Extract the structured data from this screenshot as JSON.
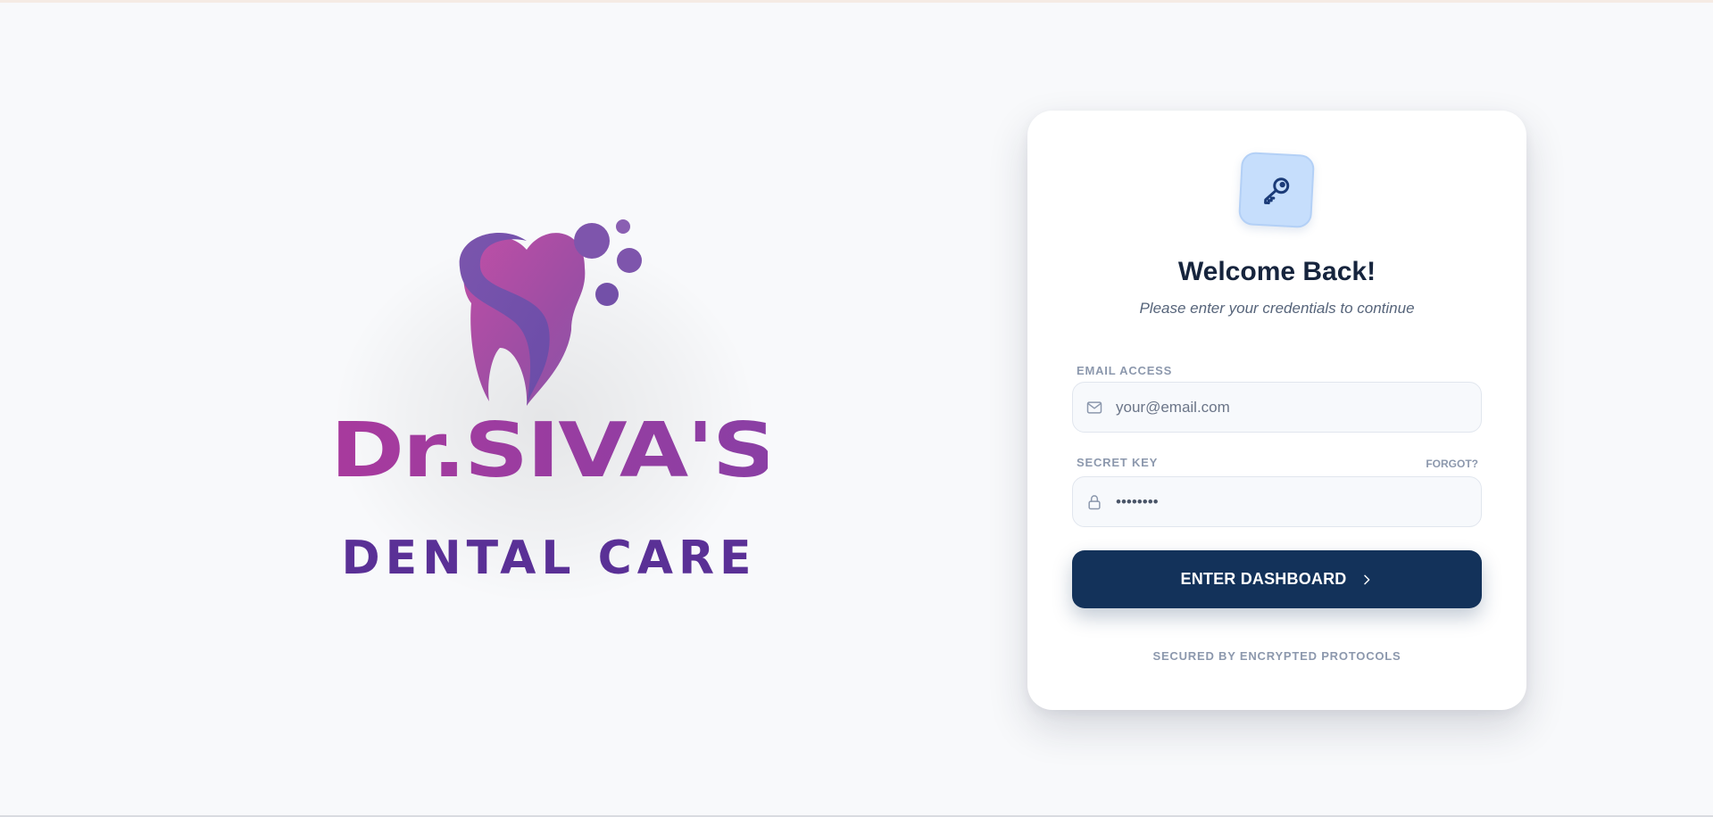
{
  "brand": {
    "title": "Dr.SIVA'S",
    "subtitle": "DENTAL CARE",
    "logo_icon": "tooth-logo-icon"
  },
  "login": {
    "badge_icon": "key-icon",
    "title": "Welcome Back!",
    "subtitle": "Please enter your credentials to continue",
    "email_label": "EMAIL ACCESS",
    "email_placeholder": "your@email.com",
    "email_icon": "mail-icon",
    "password_label": "SECRET KEY",
    "forgot_label": "FORGOT?",
    "password_value": "••••••••",
    "password_icon": "lock-icon",
    "submit_label": "ENTER DASHBOARD",
    "submit_icon": "chevron-right-icon",
    "footer_text": "SECURED BY ENCRYPTED PROTOCOLS"
  },
  "colors": {
    "primary": "#13325a",
    "badge_bg": "#c6defc",
    "brand_magenta": "#a83a9d",
    "brand_purple": "#5a3096",
    "background": "#f8f9fb"
  }
}
